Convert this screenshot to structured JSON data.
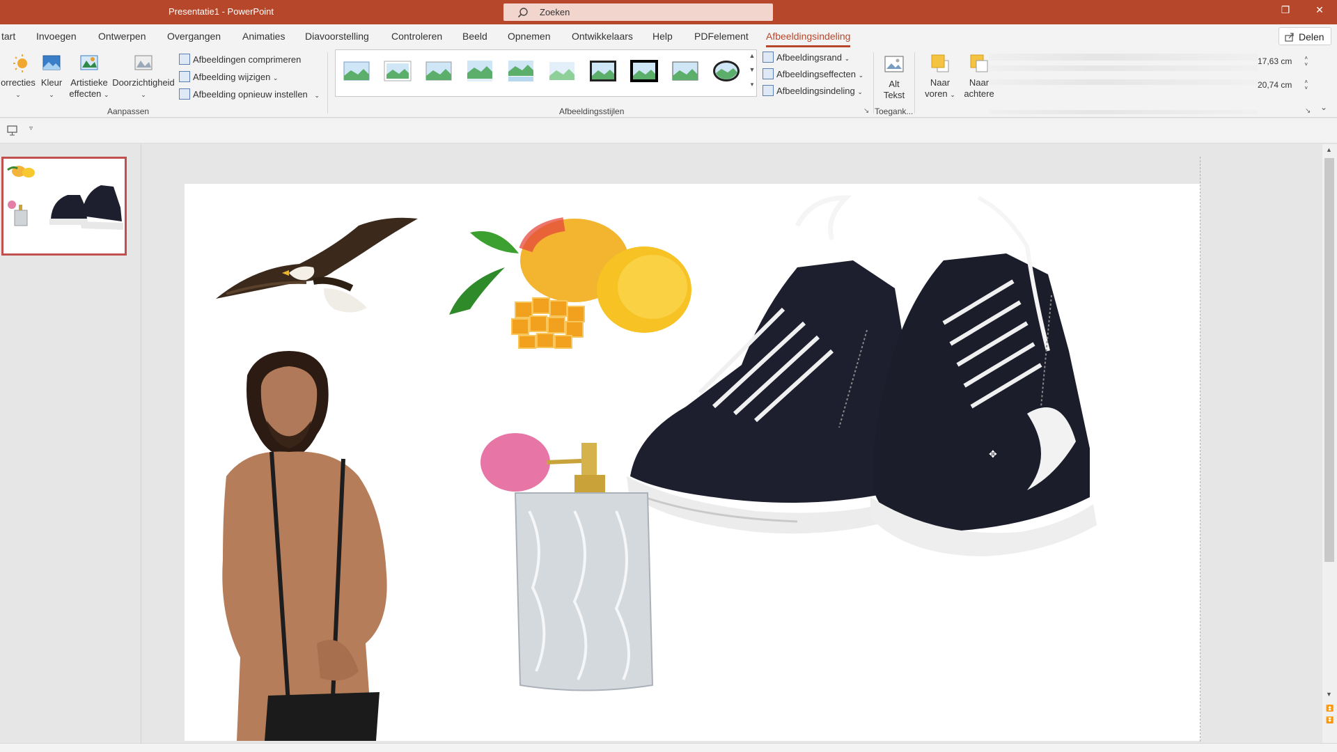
{
  "titlebar": {
    "title": "Presentatie1  -  PowerPoint",
    "search_placeholder": "Zoeken"
  },
  "tabs": [
    {
      "label": "tart"
    },
    {
      "label": "Invoegen"
    },
    {
      "label": "Ontwerpen"
    },
    {
      "label": "Overgangen"
    },
    {
      "label": "Animaties"
    },
    {
      "label": "Diavoorstelling"
    },
    {
      "label": "Controleren"
    },
    {
      "label": "Beeld"
    },
    {
      "label": "Opnemen"
    },
    {
      "label": "Ontwikkelaars"
    },
    {
      "label": "Help"
    },
    {
      "label": "PDFelement"
    },
    {
      "label": "Afbeeldingsindeling",
      "active": true
    }
  ],
  "share_label": "Delen",
  "ribbon": {
    "adjust": {
      "corrections_label": "orrecties",
      "color_label": "Kleur",
      "artistic_label_1": "Artistieke",
      "artistic_label_2": "effecten",
      "transparency_label": "Doorzichtigheid",
      "compress_label": "Afbeeldingen comprimeren",
      "change_label": "Afbeelding wijzigen",
      "reset_label": "Afbeelding opnieuw instellen",
      "group_label": "Aanpassen"
    },
    "styles": {
      "group_label": "Afbeeldingsstijlen",
      "border_label": "Afbeeldingsrand",
      "effects_label": "Afbeeldingseffecten",
      "layout_label": "Afbeeldingsindeling"
    },
    "accessibility": {
      "alt_label_1": "Alt",
      "alt_label_2": "Tekst",
      "group_label": "Toegank..."
    },
    "arrange": {
      "forward_label_1": "Naar",
      "forward_label_2": "voren",
      "backward_label_1": "Naar",
      "backward_label_2": "achtere"
    },
    "size": {
      "height": "17,63 cm",
      "width": "20,74 cm"
    }
  },
  "slide_objects": [
    {
      "name": "eagle"
    },
    {
      "name": "mango"
    },
    {
      "name": "sneakers"
    },
    {
      "name": "man"
    },
    {
      "name": "perfume"
    }
  ],
  "colors": {
    "accent": "#b7472a",
    "thumb_border": "#c0504d"
  }
}
